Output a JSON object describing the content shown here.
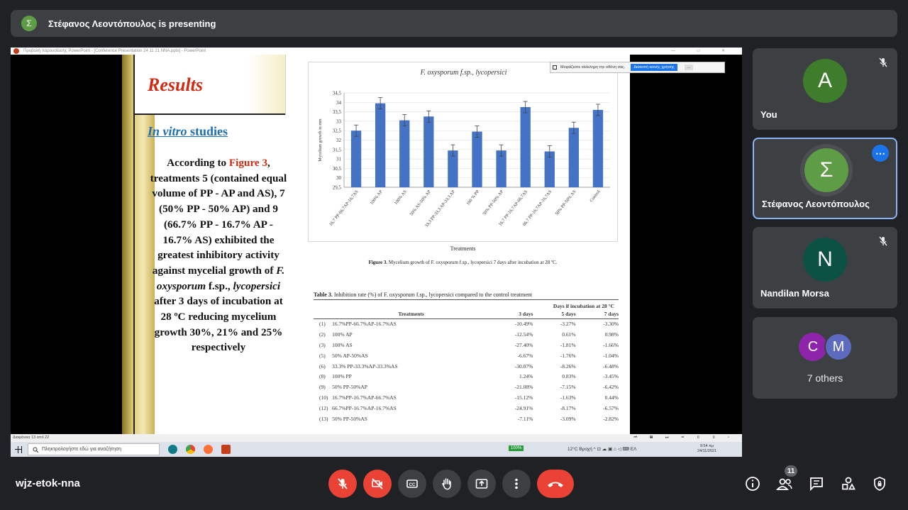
{
  "banner": {
    "avatar_letter": "Σ",
    "text": "Στέφανος Λεοντόπουλος is presenting"
  },
  "ppt": {
    "window_title": "Προβολή παρουσίασης PowerPoint - [Conference Presentation 24 11 21 NNA.pptx] - PowerPoint",
    "window_controls": "— ▭ ✕",
    "notification": {
      "text": "Μοιράζεστε ολόκληρη την οθόνη σας.",
      "button": "Διακοπή κοινής χρήσης",
      "more": "..."
    },
    "status": "Διαφάνεια 13 από 22",
    "status_icons": "⏮ ▤ ⏭ ▭ ▯ ▯ ▫",
    "taskbar": {
      "search_placeholder": "Πληκτρολογήστε εδώ για αναζήτηση",
      "battery": "100%",
      "weather": "12°C Βροχή",
      "tray_icons": "^ ⊡ ☁ ▣ ⌂ ◁ ⌨ ΕΛ",
      "time": "9:54 πμ",
      "date": "24/11/2021"
    }
  },
  "slide": {
    "heading": "Results",
    "subheading_italic": "In vitro",
    "subheading_rest": " studies",
    "para_before": "According to ",
    "para_fig": "Figure 3",
    "para_body": ", treatments 5 (contained equal volume of PP - AP and AS), 7 (50% PP - 50% AP) and 9 (66.7% PP - 16.7% AP - 16.7% AS) exhibited the greatest inhibitory activity against mycelial growth of ",
    "para_species": "F. oxysporum",
    "para_mid": " f.sp., ",
    "para_forma": "lycopersici",
    "para_after": " after 3 days of incubation at 28 ºC reducing mycelium growth 30%, 21% and 25% respectively",
    "chart_title_italic1": "F. oxysporum",
    "chart_title_mid": " f.sp., ",
    "chart_title_italic2": "lycopersici",
    "x_title": "Treatments",
    "fig_caption_bold": "Figure 3.",
    "fig_caption": " Mycelium growth of F. oxysporum f.sp., lycopersici 7 days after incubation at 28 ºC.",
    "table_caption_bold": "Table 3.",
    "table_caption": " Inhibition rate (%) of F. oxysporum f.sp., lycopersici compared to the control treatment",
    "table": {
      "group_header": "Days if incubation at 28 °C",
      "headers": [
        "Treatments",
        "3 days",
        "5 days",
        "7 days"
      ],
      "rows": [
        [
          "(1)",
          "16.7%PP-66.7%AP-16.7%AS",
          "-10.49%",
          "-3.27%",
          "-3.30%"
        ],
        [
          "(2)",
          "100% AP",
          "-12.54%",
          "0.61%",
          "0.98%"
        ],
        [
          "(3)",
          "100% AS",
          "-27.40%",
          "-1.81%",
          "-1.66%"
        ],
        [
          "(5)",
          "50% AP-50%AS",
          "-6.67%",
          "-1.76%",
          "-1.04%"
        ],
        [
          "(6)",
          "33.3% PP-33.3%AP-33.3%AS",
          "-30.07%",
          "-8.26%",
          "-6.48%"
        ],
        [
          "(8)",
          "100% PP",
          "1.24%",
          "0.83%",
          "-3.45%"
        ],
        [
          "(9)",
          "50% PP-50%AP",
          "-21.08%",
          "-7.15%",
          "-6.42%"
        ],
        [
          "(10)",
          "16.7%PP-16.7%AP-66.7%AS",
          "-15.12%",
          "-1.63%",
          "0.44%"
        ],
        [
          "(12)",
          "66.7%PP-16.7%AP-16.7%AS",
          "-24.91%",
          "-8.17%",
          "-6.57%"
        ],
        [
          "(13)",
          "50% PP-50%AS",
          "-7.11%",
          "-3.09%",
          "-2.82%"
        ]
      ]
    }
  },
  "chart_data": {
    "type": "bar",
    "title": "F. oxysporum f.sp., lycopersici",
    "xlabel": "Treatments",
    "ylabel": "Mycelium growth in mm",
    "categories": [
      "16,7 PP-66,7AP-16,7AS",
      "100% AP",
      "100% AS",
      "50% AS-50% AP",
      "33,3 PP-33,3 AP-33,3 AP",
      "100 % PP",
      "50% PP-50% AP",
      "16,7 PP-16,7AP-66,7AS",
      "66,7 PP-16,7AP-16,7AS",
      "50% PP-50% AS",
      "Control"
    ],
    "values": [
      32.5,
      33.95,
      33.05,
      33.25,
      31.45,
      32.45,
      31.45,
      33.75,
      31.4,
      32.65,
      33.6
    ],
    "errors": [
      0.3,
      0.3,
      0.3,
      0.3,
      0.3,
      0.3,
      0.3,
      0.3,
      0.3,
      0.3,
      0.3
    ],
    "ylim": [
      29.5,
      34.5
    ],
    "yticks": [
      "34,5",
      "34",
      "33,5",
      "33",
      "32,5",
      "32",
      "31,5",
      "31",
      "30,5",
      "30",
      "29,5"
    ],
    "bar_color": "#4472c4",
    "grid": true
  },
  "participants": [
    {
      "letter": "A",
      "name": "You",
      "color": "#3f7d2c"
    },
    {
      "letter": "Σ",
      "name": "Στέφανος Λεοντόπουλος",
      "color": "#5e9c45"
    },
    {
      "letter": "N",
      "name": "Nandilan Morsa",
      "color": "#0b5245"
    }
  ],
  "others": {
    "letters": [
      "C",
      "M"
    ],
    "colors": [
      "#8e24aa",
      "#5c6bc0"
    ],
    "label": "7 others"
  },
  "meeting": {
    "code": "wjz-etok-nna",
    "participant_count": "11"
  },
  "colors": {
    "background": "#202124",
    "tile": "#3c4043",
    "danger": "#ea4335",
    "accent": "#1a73e8"
  }
}
